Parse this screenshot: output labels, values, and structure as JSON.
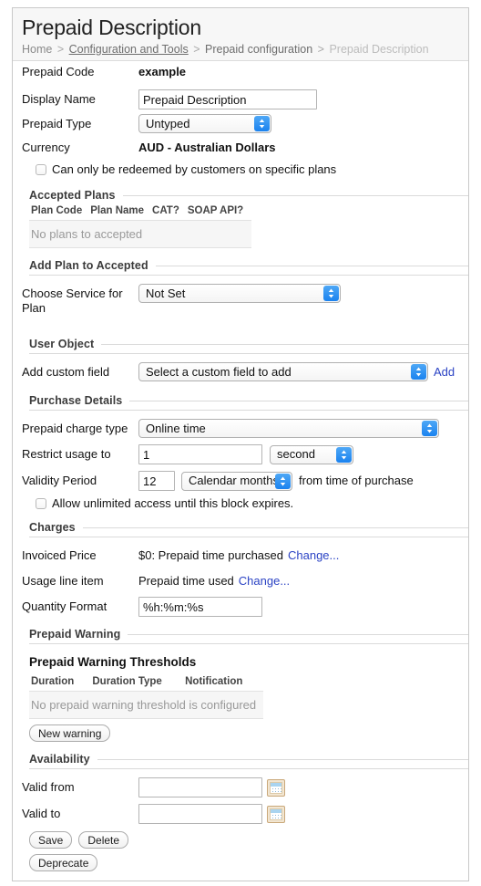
{
  "header": {
    "title": "Prepaid Description",
    "breadcrumb": [
      {
        "label": "Home",
        "style": "plain"
      },
      {
        "label": "Configuration and Tools",
        "style": "link"
      },
      {
        "label": "Prepaid configuration",
        "style": "strong"
      },
      {
        "label": "Prepaid Description",
        "style": "current"
      }
    ],
    "separator": ">"
  },
  "general": {
    "prepaid_code_label": "Prepaid Code",
    "prepaid_code_value": "example",
    "display_name_label": "Display Name",
    "display_name_value": "Prepaid Description",
    "prepaid_type_label": "Prepaid Type",
    "prepaid_type_value": "Untyped",
    "currency_label": "Currency",
    "currency_value": "AUD - Australian Dollars",
    "specific_plans_checkbox": "Can only be redeemed by customers on specific plans"
  },
  "accepted_plans": {
    "section_title": "Accepted Plans",
    "columns": [
      "Plan Code",
      "Plan Name",
      "CAT?",
      "SOAP API?"
    ],
    "empty_message": "No plans to accepted"
  },
  "add_plan": {
    "section_title": "Add Plan to Accepted",
    "choose_service_label": "Choose Service for Plan",
    "choose_service_value": "Not Set"
  },
  "user_object": {
    "section_title": "User Object",
    "add_custom_field_label": "Add custom field",
    "add_custom_field_value": "Select a custom field to add",
    "add_link": "Add"
  },
  "purchase_details": {
    "section_title": "Purchase Details",
    "charge_type_label": "Prepaid charge type",
    "charge_type_value": "Online time",
    "restrict_usage_label": "Restrict usage to",
    "restrict_usage_value": "1",
    "restrict_usage_unit": "second",
    "validity_period_label": "Validity Period",
    "validity_period_value": "12",
    "validity_period_unit": "Calendar months",
    "validity_period_suffix": "from time of purchase",
    "unlimited_checkbox": "Allow unlimited access until this block expires."
  },
  "charges": {
    "section_title": "Charges",
    "invoiced_price_label": "Invoiced Price",
    "invoiced_price_value": "$0: Prepaid time purchased",
    "invoiced_price_change": "Change...",
    "usage_line_item_label": "Usage line item",
    "usage_line_item_value": "Prepaid time used",
    "usage_line_item_change": "Change...",
    "quantity_format_label": "Quantity Format",
    "quantity_format_value": "%h:%m:%s"
  },
  "prepaid_warning": {
    "section_title": "Prepaid Warning",
    "sub_heading": "Prepaid Warning Thresholds",
    "columns": [
      "Duration",
      "Duration Type",
      "Notification"
    ],
    "empty_message": "No prepaid warning threshold is configured",
    "new_warning_button": "New warning"
  },
  "availability": {
    "section_title": "Availability",
    "valid_from_label": "Valid from",
    "valid_from_value": "",
    "valid_to_label": "Valid to",
    "valid_to_value": "",
    "date_placeholder": ""
  },
  "actions": {
    "save": "Save",
    "delete": "Delete",
    "deprecate": "Deprecate"
  },
  "icons": {
    "select_arrows": "updown-chevron-icon",
    "calendar": "calendar-icon"
  },
  "colors": {
    "accent_blue": "#1a82ef",
    "link_blue": "#2b43c4",
    "muted_text": "#999999",
    "header_bg": "#f7f7f7",
    "border": "#c9c9c9"
  }
}
